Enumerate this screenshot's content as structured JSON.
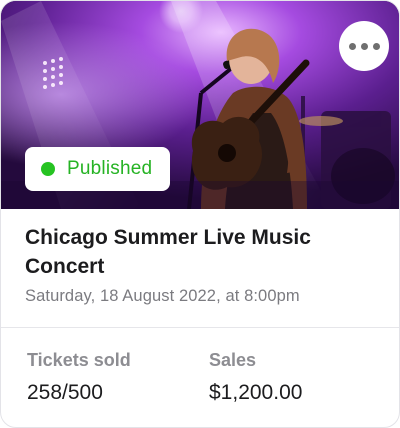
{
  "event": {
    "title": "Chicago Summer Live Music Concert",
    "date": "Saturday, 18 August 2022, at 8:00pm",
    "status": "Published",
    "status_color": "#26c322"
  },
  "stats": {
    "tickets_label": "Tickets sold",
    "tickets_value": "258/500",
    "sales_label": "Sales",
    "sales_value": "$1,200.00"
  },
  "icons": {
    "more": "more-horizontal-icon",
    "status": "status-dot-icon"
  }
}
